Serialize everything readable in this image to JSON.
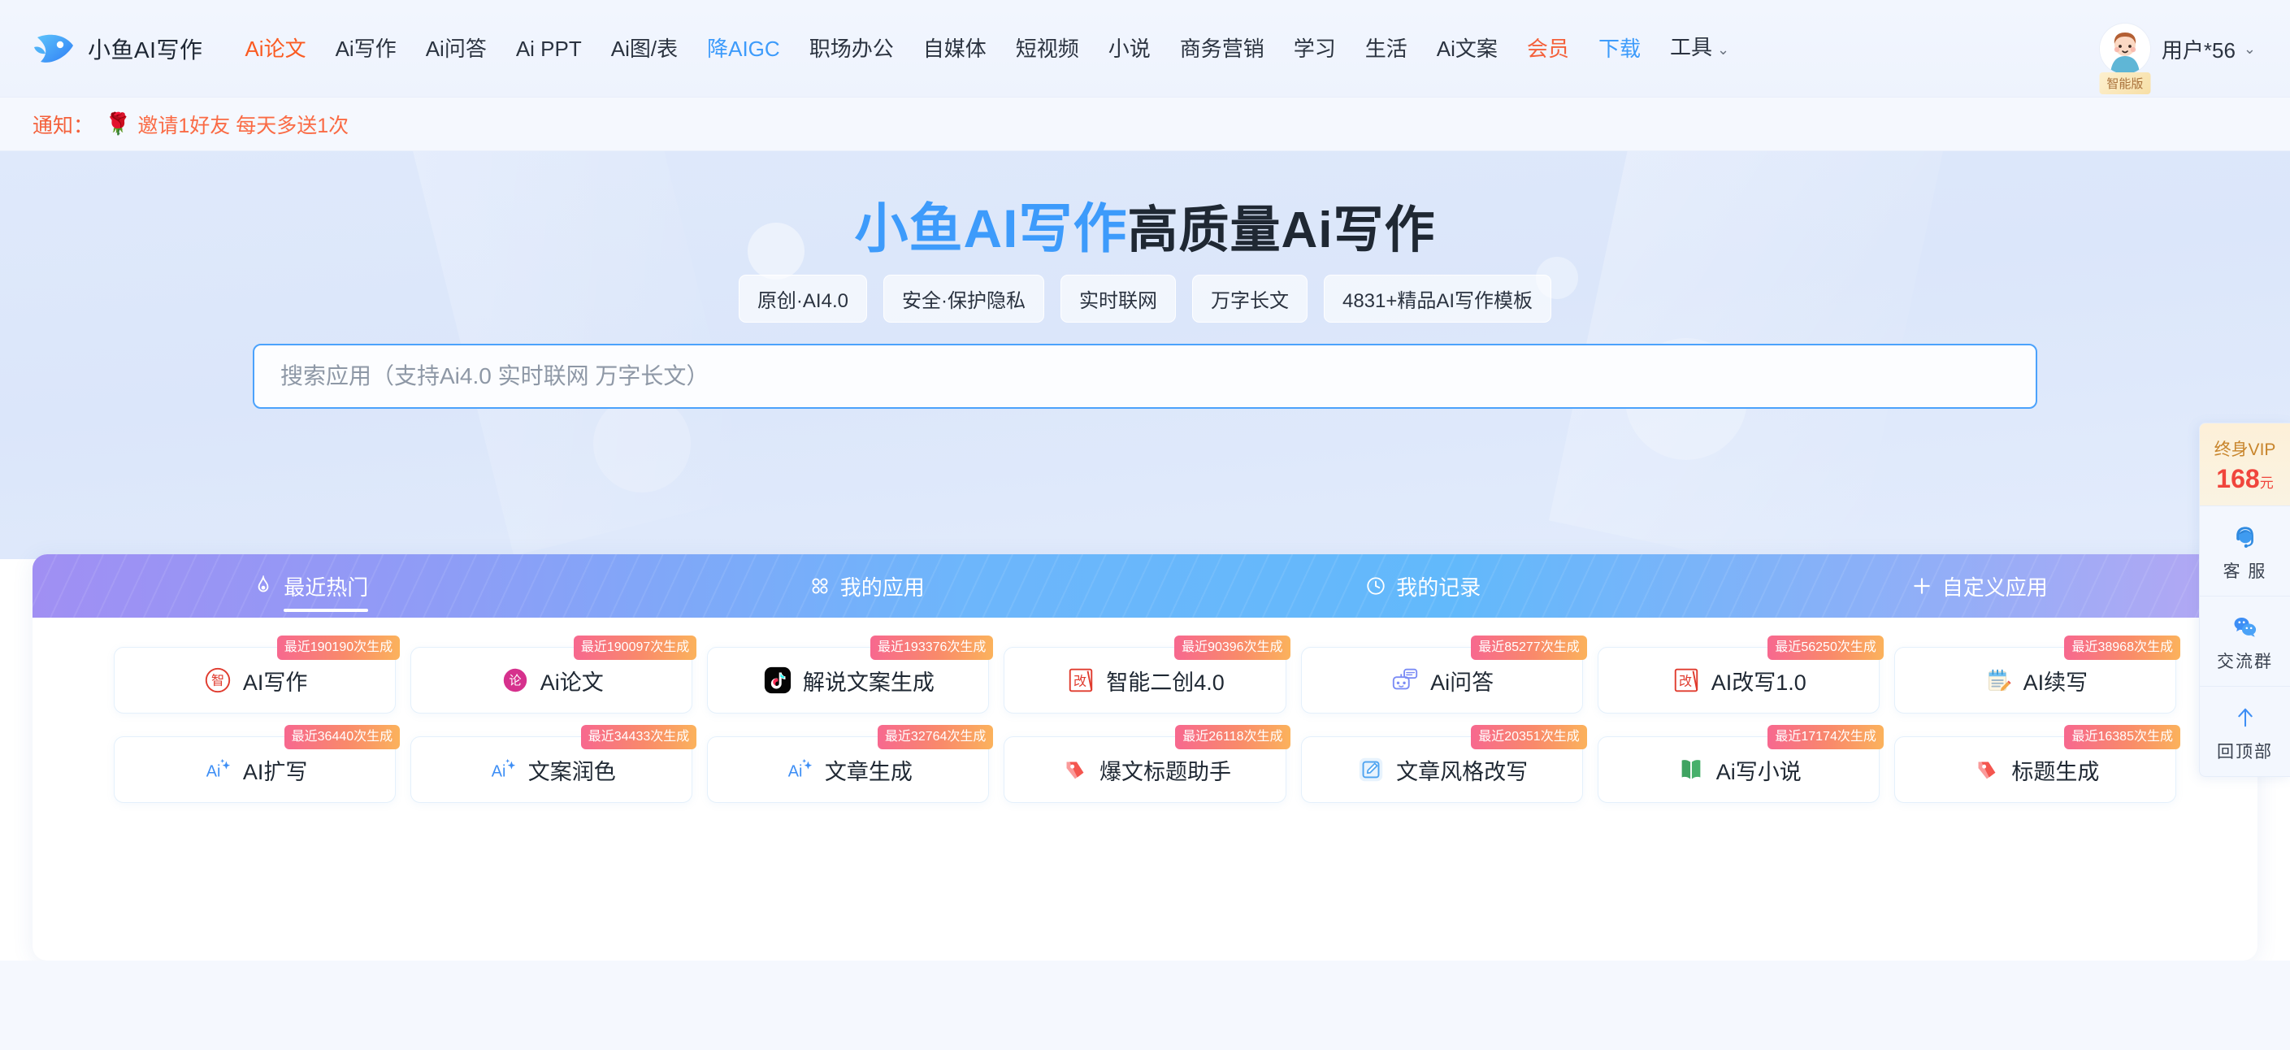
{
  "header": {
    "brand": {
      "name": "小鱼AI写作",
      "logo_icon": "fish-logo-icon"
    },
    "nav": [
      {
        "label": "Ai论文",
        "style": "accent-orange"
      },
      {
        "label": "Ai写作",
        "style": ""
      },
      {
        "label": "Ai问答",
        "style": ""
      },
      {
        "label": "Ai PPT",
        "style": ""
      },
      {
        "label": "Ai图/表",
        "style": ""
      },
      {
        "label": "降AIGC",
        "style": "accent-blue"
      },
      {
        "label": "职场办公",
        "style": ""
      },
      {
        "label": "自媒体",
        "style": ""
      },
      {
        "label": "短视频",
        "style": ""
      },
      {
        "label": "小说",
        "style": ""
      },
      {
        "label": "商务营销",
        "style": ""
      },
      {
        "label": "学习",
        "style": ""
      },
      {
        "label": "生活",
        "style": ""
      },
      {
        "label": "Ai文案",
        "style": ""
      },
      {
        "label": "会员",
        "style": "accent-red"
      },
      {
        "label": "下载",
        "style": "accent-blue"
      },
      {
        "label": "工具",
        "style": "",
        "caret": true
      }
    ],
    "user": {
      "name": "用户*56",
      "badge": "智能版",
      "avatar_icon": "user-avatar",
      "caret_icon": "chevron-down-icon"
    }
  },
  "notice": {
    "label": "通知：",
    "emoji": "🌹",
    "text": "邀请1好友 每天多送1次"
  },
  "hero": {
    "title_highlight": "小鱼AI写作",
    "title_rest": "高质量Ai写作",
    "tags": [
      "原创·AI4.0",
      "安全·保护隐私",
      "实时联网",
      "万字长文",
      "4831+精品AI写作模板"
    ],
    "search_placeholder": "搜索应用（支持Ai4.0 实时联网 万字长文）",
    "search_value": ""
  },
  "panel": {
    "tabs": [
      {
        "label": "最近热门",
        "icon": "flame-icon",
        "active": true
      },
      {
        "label": "我的应用",
        "icon": "grid-icon",
        "active": false
      },
      {
        "label": "我的记录",
        "icon": "clock-icon",
        "active": false
      },
      {
        "label": "自定义应用",
        "icon": "plus-icon",
        "active": false
      }
    ],
    "cards": [
      {
        "label": "AI写作",
        "badge": "最近190190次生成",
        "icon": "seal-zhi-icon"
      },
      {
        "label": "Ai论文",
        "badge": "最近190097次生成",
        "icon": "circle-lun-icon"
      },
      {
        "label": "解说文案生成",
        "badge": "最近193376次生成",
        "icon": "tiktok-icon"
      },
      {
        "label": "智能二创4.0",
        "badge": "最近90396次生成",
        "icon": "square-gai-icon"
      },
      {
        "label": "Ai问答",
        "badge": "最近85277次生成",
        "icon": "robot-chat-icon"
      },
      {
        "label": "AI改写1.0",
        "badge": "最近56250次生成",
        "icon": "square-gai-icon"
      },
      {
        "label": "AI续写",
        "badge": "最近38968次生成",
        "icon": "notepad-pencil-icon"
      },
      {
        "label": "AI扩写",
        "badge": "最近36440次生成",
        "icon": "ai-sparkle-icon"
      },
      {
        "label": "文案润色",
        "badge": "最近34433次生成",
        "icon": "ai-sparkle-icon"
      },
      {
        "label": "文章生成",
        "badge": "最近32764次生成",
        "icon": "ai-sparkle-icon"
      },
      {
        "label": "爆文标题助手",
        "badge": "最近26118次生成",
        "icon": "tag-icon"
      },
      {
        "label": "文章风格改写",
        "badge": "最近20351次生成",
        "icon": "edit-square-icon"
      },
      {
        "label": "Ai写小说",
        "badge": "最近17174次生成",
        "icon": "open-book-icon"
      },
      {
        "label": "标题生成",
        "badge": "最近16385次生成",
        "icon": "tag-icon"
      }
    ]
  },
  "dock": {
    "vip": {
      "title": "终身VIP",
      "price": "168",
      "unit": "元"
    },
    "items": [
      {
        "label": "客 服",
        "icon": "headset-support-icon"
      },
      {
        "label": "交流群",
        "icon": "wechat-icon"
      },
      {
        "label": "回顶部",
        "icon": "arrow-up-icon"
      }
    ]
  },
  "colors": {
    "accent_blue": "#3d9bfb",
    "accent_orange": "#fa5a21",
    "notice_red": "#f4603a",
    "badge_gradient_start": "#f7688f",
    "badge_gradient_end": "#fbb25c",
    "vip_price": "#f0453c"
  }
}
